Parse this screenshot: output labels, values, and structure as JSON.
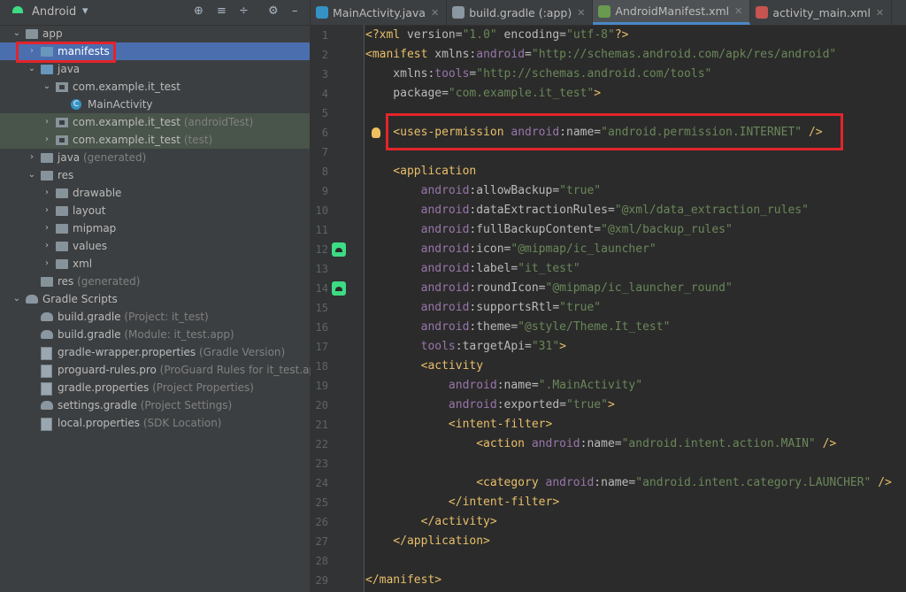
{
  "project_panel": {
    "view_selector": "Android",
    "toolbar_icons": [
      "crosshair-icon",
      "expand-all-icon",
      "collapse-all-icon",
      "gear-icon",
      "minimize-icon"
    ],
    "tree": [
      {
        "label": "app",
        "suffix": "",
        "depth": 0,
        "arrow": "down",
        "icon": "folder"
      },
      {
        "label": "manifests",
        "suffix": "",
        "depth": 1,
        "arrow": "right",
        "icon": "folder-blue",
        "selected": true
      },
      {
        "label": "java",
        "suffix": "",
        "depth": 1,
        "arrow": "down",
        "icon": "folder-blue"
      },
      {
        "label": "com.example.it_test",
        "suffix": "",
        "depth": 2,
        "arrow": "down",
        "icon": "package"
      },
      {
        "label": "MainActivity",
        "suffix": "",
        "depth": 3,
        "arrow": "",
        "icon": "class"
      },
      {
        "label": "com.example.it_test",
        "suffix": "(androidTest)",
        "depth": 2,
        "arrow": "right",
        "icon": "package",
        "highlight": true
      },
      {
        "label": "com.example.it_test",
        "suffix": "(test)",
        "depth": 2,
        "arrow": "right",
        "icon": "package",
        "highlight": true
      },
      {
        "label": "java",
        "suffix": "(generated)",
        "depth": 1,
        "arrow": "right",
        "icon": "folder"
      },
      {
        "label": "res",
        "suffix": "",
        "depth": 1,
        "arrow": "down",
        "icon": "folder"
      },
      {
        "label": "drawable",
        "suffix": "",
        "depth": 2,
        "arrow": "right",
        "icon": "folder"
      },
      {
        "label": "layout",
        "suffix": "",
        "depth": 2,
        "arrow": "right",
        "icon": "folder"
      },
      {
        "label": "mipmap",
        "suffix": "",
        "depth": 2,
        "arrow": "right",
        "icon": "folder"
      },
      {
        "label": "values",
        "suffix": "",
        "depth": 2,
        "arrow": "right",
        "icon": "folder"
      },
      {
        "label": "xml",
        "suffix": "",
        "depth": 2,
        "arrow": "right",
        "icon": "folder"
      },
      {
        "label": "res",
        "suffix": "(generated)",
        "depth": 1,
        "arrow": "",
        "icon": "folder"
      },
      {
        "label": "Gradle Scripts",
        "suffix": "",
        "depth": 0,
        "arrow": "down",
        "icon": "elephant"
      },
      {
        "label": "build.gradle",
        "suffix": "(Project: it_test)",
        "depth": 1,
        "arrow": "",
        "icon": "elephant"
      },
      {
        "label": "build.gradle",
        "suffix": "(Module: it_test.app)",
        "depth": 1,
        "arrow": "",
        "icon": "elephant"
      },
      {
        "label": "gradle-wrapper.properties",
        "suffix": "(Gradle Version)",
        "depth": 1,
        "arrow": "",
        "icon": "propfile"
      },
      {
        "label": "proguard-rules.pro",
        "suffix": "(ProGuard Rules for it_test.app)",
        "depth": 1,
        "arrow": "",
        "icon": "propfile"
      },
      {
        "label": "gradle.properties",
        "suffix": "(Project Properties)",
        "depth": 1,
        "arrow": "",
        "icon": "propfile"
      },
      {
        "label": "settings.gradle",
        "suffix": "(Project Settings)",
        "depth": 1,
        "arrow": "",
        "icon": "elephant"
      },
      {
        "label": "local.properties",
        "suffix": "(SDK Location)",
        "depth": 1,
        "arrow": "",
        "icon": "propfile"
      }
    ]
  },
  "tabs": [
    {
      "label": "MainActivity.java",
      "icon": "java-class-icon",
      "color": "#3592c4",
      "active": false
    },
    {
      "label": "build.gradle (:app)",
      "icon": "gradle-icon",
      "color": "#8a96a0",
      "active": false
    },
    {
      "label": "AndroidManifest.xml",
      "icon": "manifest-icon",
      "color": "#6a9a4f",
      "active": true
    },
    {
      "label": "activity_main.xml",
      "icon": "layout-xml-icon",
      "color": "#c75450",
      "active": false
    }
  ],
  "editor": {
    "lines": [
      [
        [
          "?xml",
          "t-tag",
          "<"
        ],
        [
          " version=",
          "t-attr"
        ],
        [
          "\"1.0\"",
          "t-val"
        ],
        [
          " encoding=",
          "t-attr"
        ],
        [
          "\"utf-8\"",
          "t-val"
        ],
        [
          "?>",
          "t-tag"
        ]
      ],
      [
        [
          "<manifest",
          "t-tag"
        ],
        [
          " xmlns:",
          "t-attr"
        ],
        [
          "android",
          "t-ns"
        ],
        [
          "=",
          "t-attr"
        ],
        [
          "\"http://schemas.android.com/apk/res/android\"",
          "t-val"
        ]
      ],
      [
        [
          "    xmlns:",
          "t-attr"
        ],
        [
          "tools",
          "t-ns"
        ],
        [
          "=",
          "t-attr"
        ],
        [
          "\"http://schemas.android.com/tools\"",
          "t-val"
        ]
      ],
      [
        [
          "    package=",
          "t-attr"
        ],
        [
          "\"com.example.it_test\"",
          "t-val"
        ],
        [
          ">",
          "t-tag"
        ]
      ],
      [],
      [
        [
          "    <uses-permission",
          "t-tag"
        ],
        [
          " android",
          "t-ns"
        ],
        [
          ":name=",
          "t-attr"
        ],
        [
          "\"android.permission.INTERNET\"",
          "t-val"
        ],
        [
          " />",
          "t-tag"
        ]
      ],
      [],
      [
        [
          "    <application",
          "t-tag"
        ]
      ],
      [
        [
          "        android",
          "t-ns"
        ],
        [
          ":allowBackup=",
          "t-attr"
        ],
        [
          "\"true\"",
          "t-val"
        ]
      ],
      [
        [
          "        android",
          "t-ns"
        ],
        [
          ":dataExtractionRules=",
          "t-attr"
        ],
        [
          "\"@xml/data_extraction_rules\"",
          "t-val"
        ]
      ],
      [
        [
          "        android",
          "t-ns"
        ],
        [
          ":fullBackupContent=",
          "t-attr"
        ],
        [
          "\"@xml/backup_rules\"",
          "t-val"
        ]
      ],
      [
        [
          "        android",
          "t-ns"
        ],
        [
          ":icon=",
          "t-attr"
        ],
        [
          "\"@mipmap/ic_launcher\"",
          "t-val"
        ]
      ],
      [
        [
          "        android",
          "t-ns"
        ],
        [
          ":label=",
          "t-attr"
        ],
        [
          "\"it_test\"",
          "t-val"
        ]
      ],
      [
        [
          "        android",
          "t-ns"
        ],
        [
          ":roundIcon=",
          "t-attr"
        ],
        [
          "\"@mipmap/ic_launcher_round\"",
          "t-val"
        ]
      ],
      [
        [
          "        android",
          "t-ns"
        ],
        [
          ":supportsRtl=",
          "t-attr"
        ],
        [
          "\"true\"",
          "t-val"
        ]
      ],
      [
        [
          "        android",
          "t-ns"
        ],
        [
          ":theme=",
          "t-attr"
        ],
        [
          "\"@style/Theme.It_test\"",
          "t-val"
        ]
      ],
      [
        [
          "        tools",
          "t-ns"
        ],
        [
          ":targetApi=",
          "t-attr"
        ],
        [
          "\"31\"",
          "t-val"
        ],
        [
          ">",
          "t-tag"
        ]
      ],
      [
        [
          "        <activity",
          "t-tag"
        ]
      ],
      [
        [
          "            android",
          "t-ns"
        ],
        [
          ":name=",
          "t-attr"
        ],
        [
          "\".MainActivity\"",
          "t-val"
        ]
      ],
      [
        [
          "            android",
          "t-ns"
        ],
        [
          ":exported=",
          "t-attr"
        ],
        [
          "\"true\"",
          "t-val"
        ],
        [
          ">",
          "t-tag"
        ]
      ],
      [
        [
          "            <intent-filter>",
          "t-tag"
        ]
      ],
      [
        [
          "                <action",
          "t-tag"
        ],
        [
          " android",
          "t-ns"
        ],
        [
          ":name=",
          "t-attr"
        ],
        [
          "\"android.intent.action.MAIN\"",
          "t-val"
        ],
        [
          " />",
          "t-tag"
        ]
      ],
      [],
      [
        [
          "                <category",
          "t-tag"
        ],
        [
          " android",
          "t-ns"
        ],
        [
          ":name=",
          "t-attr"
        ],
        [
          "\"android.intent.category.LAUNCHER\"",
          "t-val"
        ],
        [
          " />",
          "t-tag"
        ]
      ],
      [
        [
          "            </intent-filter>",
          "t-tag"
        ]
      ],
      [
        [
          "        </activity>",
          "t-tag"
        ]
      ],
      [
        [
          "    </application>",
          "t-tag"
        ]
      ],
      [],
      [
        [
          "</manifest>",
          "t-tag"
        ]
      ]
    ],
    "gutter_android_icons_lines": [
      12,
      14
    ],
    "bulb_line": 6
  }
}
